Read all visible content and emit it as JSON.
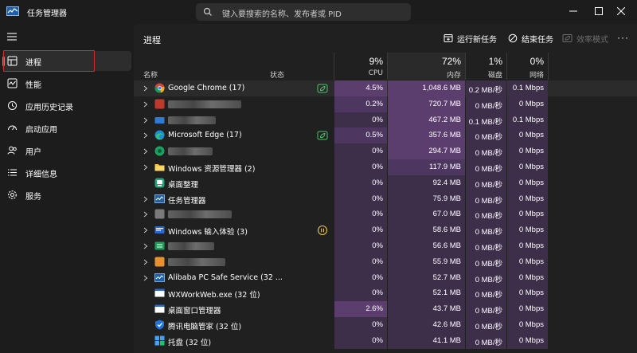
{
  "app": {
    "title": "任务管理器"
  },
  "search": {
    "placeholder": "键入要搜索的名称、发布者或 PID"
  },
  "window_controls": {
    "minimize": "–",
    "maximize": "□",
    "close": "✕"
  },
  "sidebar": {
    "items": [
      {
        "label": "进程",
        "icon": "processes-icon",
        "active": true
      },
      {
        "label": "性能",
        "icon": "performance-icon"
      },
      {
        "label": "应用历史记录",
        "icon": "app-history-icon"
      },
      {
        "label": "启动应用",
        "icon": "startup-apps-icon"
      },
      {
        "label": "用户",
        "icon": "users-icon"
      },
      {
        "label": "详细信息",
        "icon": "details-icon"
      },
      {
        "label": "服务",
        "icon": "services-icon"
      }
    ]
  },
  "page": {
    "title": "进程"
  },
  "commands": {
    "run_new_task": "运行新任务",
    "end_task": "结束任务",
    "efficiency_mode": "效率模式",
    "more": "···"
  },
  "columns": {
    "name": "名称",
    "status": "状态",
    "cpu": {
      "pct": "9%",
      "label": "CPU"
    },
    "memory": {
      "pct": "72%",
      "label": "内存"
    },
    "disk": {
      "pct": "1%",
      "label": "磁盘"
    },
    "network": {
      "pct": "0%",
      "label": "网络"
    }
  },
  "colors": {
    "accent": "#d865b0",
    "heat_light": "#3d2e4a",
    "heat_mid": "#4d3760",
    "heat_strong": "#5b3e6d",
    "highlight_box": "#d12b2b"
  },
  "rows": [
    {
      "name": "Google Chrome (17)",
      "icon": "chrome-icon",
      "expandable": true,
      "status_icon": "leaf-icon",
      "cpu": "4.5%",
      "mem": "1,048.6 MB",
      "disk": "0.2 MB/秒",
      "net": "0.1 Mbps"
    },
    {
      "name": "",
      "redacted": true,
      "icon": "red-app-icon",
      "expandable": true,
      "cpu": "0.2%",
      "mem": "720.7 MB",
      "disk": "0 MB/秒",
      "net": "0 Mbps"
    },
    {
      "name": "",
      "redacted": true,
      "icon": "blue-app-icon",
      "expandable": true,
      "cpu": "0%",
      "mem": "467.2 MB",
      "disk": "0.1 MB/秒",
      "net": "0.1 Mbps"
    },
    {
      "name": "Microsoft Edge (17)",
      "icon": "edge-icon",
      "expandable": true,
      "status_icon": "leaf-icon",
      "cpu": "0.5%",
      "mem": "357.6 MB",
      "disk": "0 MB/秒",
      "net": "0 Mbps"
    },
    {
      "name": "",
      "redacted": true,
      "icon": "green-app-icon",
      "expandable": true,
      "cpu": "0%",
      "mem": "294.7 MB",
      "disk": "0 MB/秒",
      "net": "0 Mbps"
    },
    {
      "name": "Windows 资源管理器 (2)",
      "icon": "folder-icon",
      "expandable": true,
      "cpu": "0%",
      "mem": "117.9 MB",
      "disk": "0 MB/秒",
      "net": "0 Mbps"
    },
    {
      "name": "桌面整理",
      "icon": "desktop-organizer-icon",
      "expandable": false,
      "cpu": "0%",
      "mem": "92.4 MB",
      "disk": "0 MB/秒",
      "net": "0 Mbps"
    },
    {
      "name": "任务管理器",
      "icon": "task-manager-icon",
      "expandable": true,
      "cpu": "0%",
      "mem": "75.9 MB",
      "disk": "0 MB/秒",
      "net": "0 Mbps"
    },
    {
      "name": "",
      "redacted": true,
      "icon": "gray-app-icon",
      "expandable": true,
      "cpu": "0%",
      "mem": "67.0 MB",
      "disk": "0 MB/秒",
      "net": "0 Mbps"
    },
    {
      "name": "Windows 输入体验 (3)",
      "icon": "input-experience-icon",
      "expandable": true,
      "status_icon": "pause-icon",
      "cpu": "0%",
      "mem": "58.6 MB",
      "disk": "0 MB/秒",
      "net": "0 Mbps"
    },
    {
      "name": "",
      "redacted": true,
      "icon": "green-sheet-icon",
      "expandable": true,
      "cpu": "0%",
      "mem": "56.6 MB",
      "disk": "0 MB/秒",
      "net": "0 Mbps"
    },
    {
      "name": "",
      "redacted": true,
      "icon": "orange-app-icon",
      "expandable": true,
      "cpu": "0%",
      "mem": "55.9 MB",
      "disk": "0 MB/秒",
      "net": "0 Mbps"
    },
    {
      "name": "Alibaba PC Safe Service (32 ...",
      "icon": "task-manager-icon",
      "expandable": true,
      "cpu": "0%",
      "mem": "52.7 MB",
      "disk": "0 MB/秒",
      "net": "0 Mbps"
    },
    {
      "name": "WXWorkWeb.exe (32 位)",
      "icon": "window-icon",
      "expandable": false,
      "cpu": "0%",
      "mem": "52.1 MB",
      "disk": "0 MB/秒",
      "net": "0 Mbps"
    },
    {
      "name": "桌面窗口管理器",
      "icon": "window-icon",
      "expandable": false,
      "cpu": "2.6%",
      "mem": "43.7 MB",
      "disk": "0 MB/秒",
      "net": "0 Mbps"
    },
    {
      "name": "腾讯电脑管家 (32 位)",
      "icon": "shield-icon",
      "expandable": false,
      "cpu": "0%",
      "mem": "42.6 MB",
      "disk": "0 MB/秒",
      "net": "0 Mbps"
    },
    {
      "name": "托盘 (32 位)",
      "icon": "tray-icon",
      "expandable": false,
      "cpu": "0%",
      "mem": "41.1 MB",
      "disk": "0 MB/秒",
      "net": "0 Mbps"
    }
  ]
}
